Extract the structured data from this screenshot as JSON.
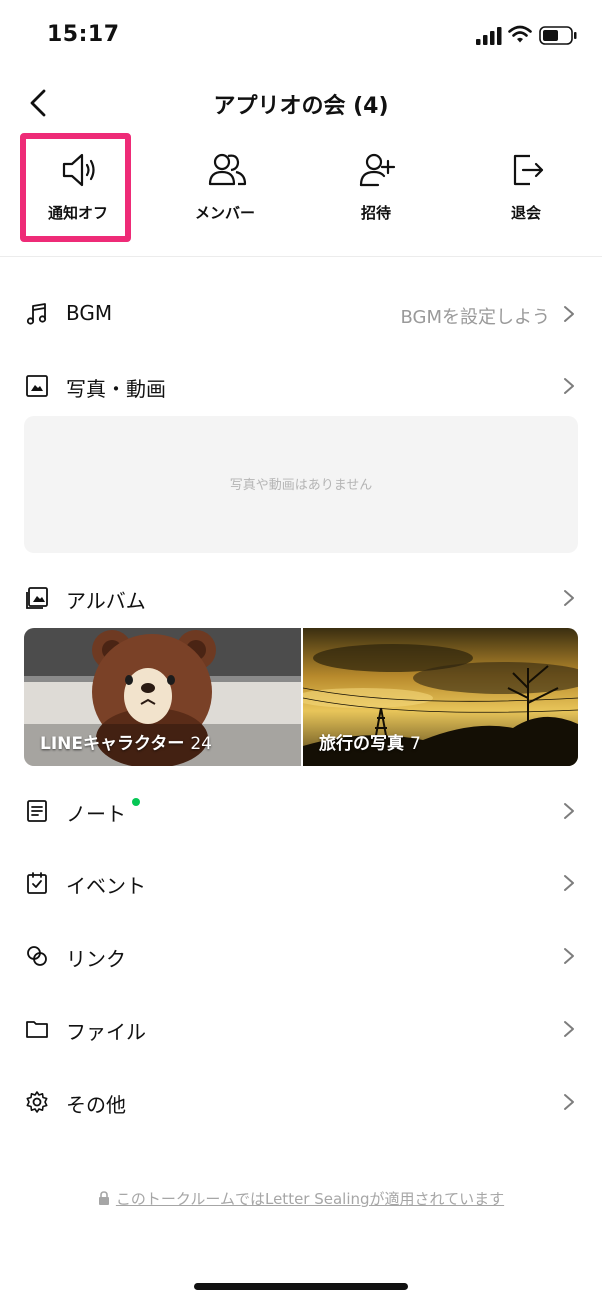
{
  "status_bar": {
    "time": "15:17"
  },
  "header": {
    "title": "アプリオの会 (4)"
  },
  "actions": [
    {
      "label": "通知オフ",
      "icon": "speaker-icon"
    },
    {
      "label": "メンバー",
      "icon": "members-icon"
    },
    {
      "label": "招待",
      "icon": "add-person-icon"
    },
    {
      "label": "退会",
      "icon": "leave-icon"
    }
  ],
  "highlight_color": "#ee2b77",
  "menu": {
    "bgm": {
      "label": "BGM",
      "value": "BGMを設定しよう"
    },
    "photos": {
      "label": "写真・動画",
      "empty_text": "写真や動画はありません"
    },
    "album": {
      "label": "アルバム",
      "items": [
        {
          "name": "LINEキャラクター",
          "count": "24"
        },
        {
          "name": "旅行の写真",
          "count": "7"
        }
      ]
    },
    "note": {
      "label": "ノート"
    },
    "event": {
      "label": "イベント"
    },
    "link": {
      "label": "リンク"
    },
    "file": {
      "label": "ファイル"
    },
    "other": {
      "label": "その他"
    }
  },
  "footer": {
    "link_text": "このトークルームでは",
    "link_text_2": "Letter Sealing",
    "link_text_3": "が適用されています"
  },
  "colors": {
    "accent_green": "#06c755",
    "text": "#111111",
    "muted": "#9a9a9a"
  }
}
